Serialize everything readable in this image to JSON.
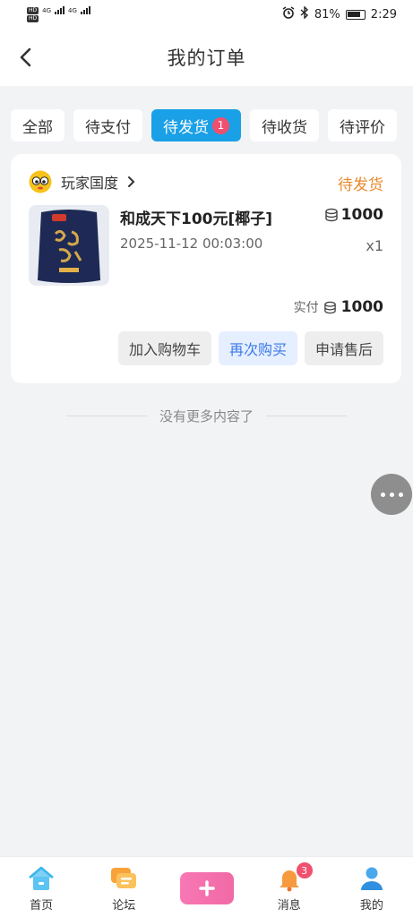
{
  "status_bar": {
    "hd_label": "HD",
    "network_label": "4G",
    "battery_text": "81%",
    "time": "2:29"
  },
  "header": {
    "title": "我的订单"
  },
  "tabs": [
    {
      "label": "全部"
    },
    {
      "label": "待支付"
    },
    {
      "label": "待发货",
      "badge": "1"
    },
    {
      "label": "待收货"
    },
    {
      "label": "待评价"
    }
  ],
  "order": {
    "shop_name": "玩家国度",
    "status": "待发货",
    "product_name": "和成天下100元[椰子]",
    "date": "2025-11-12 00:03:00",
    "price": "1000",
    "quantity": "x1",
    "paid_label": "实付",
    "paid_amount": "1000",
    "actions": {
      "add_cart": "加入购物车",
      "buy_again": "再次购买",
      "after_sale": "申请售后"
    }
  },
  "no_more_text": "没有更多内容了",
  "bottom_nav": {
    "home": "首页",
    "forum": "论坛",
    "messages": "消息",
    "messages_badge": "3",
    "mine": "我的"
  },
  "colors": {
    "accent": "#1aa0e6",
    "status_orange": "#e9892b",
    "badge_red": "#f0506e",
    "primary_button_text": "#3a7ae8"
  }
}
